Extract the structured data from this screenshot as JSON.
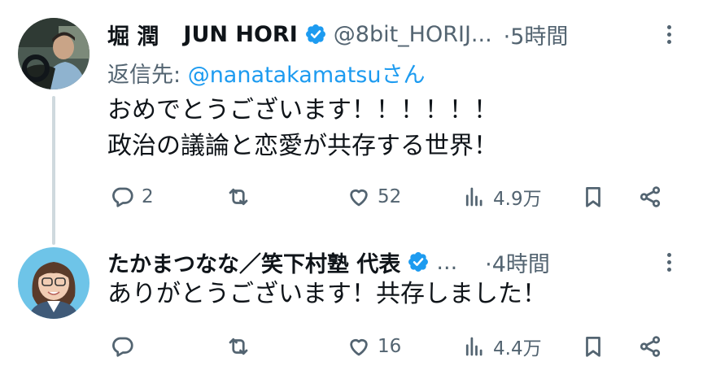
{
  "tweets": [
    {
      "display_name": "堀 潤",
      "display_name_en": "JUN HORI",
      "handle": "@8bit_HORIJ...",
      "time": "·5時間",
      "reply_prefix": "返信先: ",
      "reply_mention": "@nanatakamatsu",
      "reply_suffix": "さん",
      "text_line1": "おめでとうございます！！！！！！",
      "text_line2": "政治の議論と恋愛が共存する世界！",
      "replies": "2",
      "retweets": "",
      "likes": "52",
      "views": "4.9万"
    },
    {
      "display_name": "たかまつなな／笑下村塾 代表",
      "handle": "...",
      "time": "·4時間",
      "text_line1": "ありがとうございます！共存しました！",
      "replies": "",
      "retweets": "",
      "likes": "16",
      "views": "4.4万"
    }
  ],
  "colors": {
    "verified": "#1d9bf0",
    "muted": "#536471",
    "text": "#0f1419",
    "link": "#1d9bf0",
    "thread_line": "#cfd9de"
  },
  "icons": [
    "reply-icon",
    "retweet-icon",
    "like-icon",
    "views-icon",
    "bookmark-icon",
    "share-icon",
    "verified-badge-icon",
    "more-icon"
  ]
}
